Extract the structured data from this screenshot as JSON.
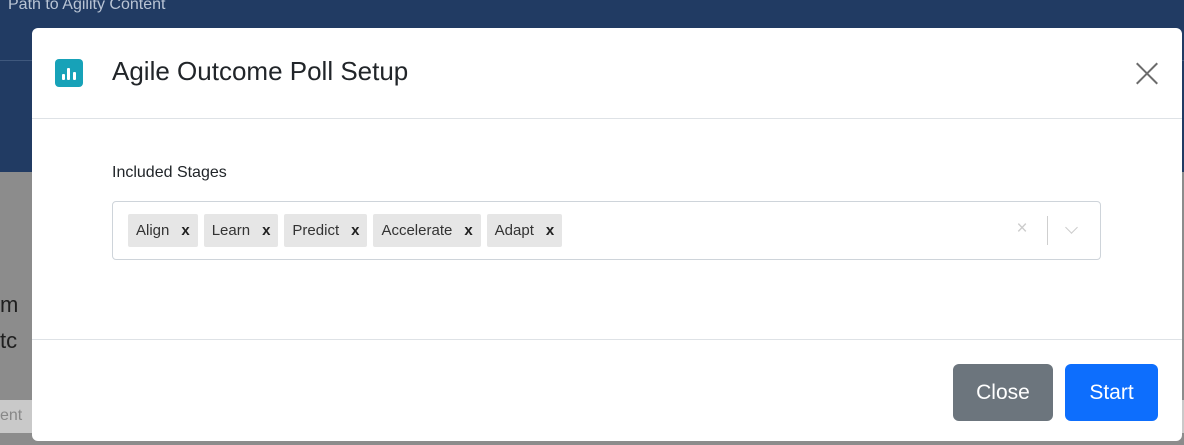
{
  "background": {
    "title": "Path to Agility Content",
    "partial_text_1": "m",
    "partial_text_2": "tc",
    "partial_bar_text": "ent"
  },
  "modal": {
    "title": "Agile Outcome Poll Setup",
    "logo_icon": "bar-chart-icon",
    "close_icon": "close-icon",
    "field_label": "Included Stages",
    "tags": [
      {
        "label": "Align",
        "remove": "x"
      },
      {
        "label": "Learn",
        "remove": "x"
      },
      {
        "label": "Predict",
        "remove": "x"
      },
      {
        "label": "Accelerate",
        "remove": "x"
      },
      {
        "label": "Adapt",
        "remove": "x"
      }
    ],
    "clear_symbol": "×",
    "buttons": {
      "close": "Close",
      "start": "Start"
    }
  },
  "colors": {
    "accent": "#17a2b8",
    "primary": "#0d6efd",
    "secondary": "#6c757d",
    "header_bg": "#213b63"
  }
}
